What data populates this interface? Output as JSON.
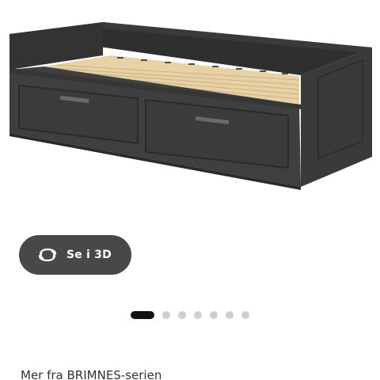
{
  "product_image": {
    "alt": "BRIMNES dagbenk med 2 skuffer, svart",
    "frame_color": "#3b3b3b",
    "slat_color": "#e9d3a9"
  },
  "view_3d": {
    "label": "Se i 3D",
    "icon": "rotate-3d-icon"
  },
  "carousel": {
    "total": 7,
    "active_index": 1
  },
  "series": {
    "heading": "Mer fra BRIMNES-serien"
  }
}
